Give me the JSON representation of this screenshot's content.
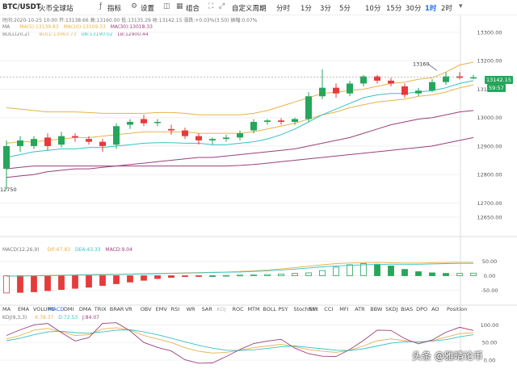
{
  "toolbar": {
    "symbol": "BTC/USDT",
    "exchange": "火币全球站",
    "indicators_label": "指标",
    "settings_label": "设置",
    "layout_label": "组合",
    "periods": [
      "分时",
      "1分",
      "3分",
      "5分",
      "10分",
      "15分",
      "30分",
      "1时",
      "2时"
    ],
    "custom_label": "自定义周期"
  },
  "info": {
    "date": "时间:2020-10-25 10:00",
    "open": "开:13138.66",
    "high": "高:13160.00",
    "low": "低:13135.29",
    "close": "收:13142.15",
    "change": "涨跌:+0.03%(3.50)",
    "amplitude": "振幅:0.07%",
    "ma_label": "MA",
    "ma5": "MA(5):13139.83",
    "ma10": "MA(10):13109.33",
    "ma30": "MA(30):13018.33",
    "boll_label": "BOLL(20,2)",
    "boll_mid": "BOLL:13063.73",
    "boll_ub": "UB:13190.02",
    "boll_lb": "LB:12900.44"
  },
  "macd_info": {
    "label": "MACD(12,26,9)",
    "diff": "DIF:67.83",
    "dea": "DEA:43.33",
    "macd": "MACD:9.04"
  },
  "kdj_info": {
    "label": "KDJ(9,3,3)",
    "k": "K:78.37",
    "d": "D:72.53",
    "j": "J:84.07"
  },
  "chart_data": {
    "type": "candlestick",
    "ylim": [
      12600,
      13300
    ],
    "yticks": [
      "13300.00",
      "13200.00",
      "13100.00",
      "13000.00",
      "12900.00",
      "12800.00",
      "12700.00",
      "12650.00"
    ],
    "current_price": "13142.15",
    "countdown": "59:57",
    "high_label": "13160",
    "low_label": "12750",
    "candles": [
      {
        "o": 12820,
        "c": 12900,
        "h": 12920,
        "l": 12750
      },
      {
        "o": 12900,
        "c": 12920,
        "h": 12935,
        "l": 12880
      },
      {
        "o": 12900,
        "c": 12925,
        "h": 12935,
        "l": 12890
      },
      {
        "o": 12930,
        "c": 12900,
        "h": 12945,
        "l": 12885
      },
      {
        "o": 12905,
        "c": 12935,
        "h": 12950,
        "l": 12895
      },
      {
        "o": 12935,
        "c": 12930,
        "h": 12945,
        "l": 12915
      },
      {
        "o": 12925,
        "c": 12915,
        "h": 12935,
        "l": 12905
      },
      {
        "o": 12915,
        "c": 12900,
        "h": 12925,
        "l": 12880
      },
      {
        "o": 12905,
        "c": 12970,
        "h": 12980,
        "l": 12890
      },
      {
        "o": 12975,
        "c": 12985,
        "h": 12995,
        "l": 12960
      },
      {
        "o": 12995,
        "c": 12980,
        "h": 13010,
        "l": 12970
      },
      {
        "o": 12985,
        "c": 12985,
        "h": 12995,
        "l": 12970
      },
      {
        "o": 12960,
        "c": 12955,
        "h": 12975,
        "l": 12940
      },
      {
        "o": 12955,
        "c": 12935,
        "h": 12965,
        "l": 12925
      },
      {
        "o": 12935,
        "c": 12920,
        "h": 12945,
        "l": 12905
      },
      {
        "o": 12920,
        "c": 12925,
        "h": 12930,
        "l": 12905
      },
      {
        "o": 12925,
        "c": 12930,
        "h": 12940,
        "l": 12915
      },
      {
        "o": 12930,
        "c": 12945,
        "h": 12955,
        "l": 12920
      },
      {
        "o": 12955,
        "c": 12985,
        "h": 12995,
        "l": 12945
      },
      {
        "o": 12985,
        "c": 12990,
        "h": 12995,
        "l": 12975
      },
      {
        "o": 12990,
        "c": 12985,
        "h": 12998,
        "l": 12975
      },
      {
        "o": 12985,
        "c": 12995,
        "h": 13000,
        "l": 12975
      },
      {
        "o": 12995,
        "c": 13075,
        "h": 13090,
        "l": 12985
      },
      {
        "o": 13075,
        "c": 13105,
        "h": 13170,
        "l": 13065
      },
      {
        "o": 13105,
        "c": 13085,
        "h": 13120,
        "l": 13070
      },
      {
        "o": 13085,
        "c": 13120,
        "h": 13130,
        "l": 13075
      },
      {
        "o": 13120,
        "c": 13145,
        "h": 13150,
        "l": 13110
      },
      {
        "o": 13145,
        "c": 13130,
        "h": 13150,
        "l": 13120
      },
      {
        "o": 13130,
        "c": 13120,
        "h": 13140,
        "l": 13110
      },
      {
        "o": 13110,
        "c": 13080,
        "h": 13120,
        "l": 13070
      },
      {
        "o": 13085,
        "c": 13095,
        "h": 13105,
        "l": 13075
      },
      {
        "o": 13095,
        "c": 13125,
        "h": 13135,
        "l": 13090
      },
      {
        "o": 13125,
        "c": 13145,
        "h": 13160,
        "l": 13115
      },
      {
        "o": 13145,
        "c": 13140,
        "h": 13160,
        "l": 13135
      },
      {
        "o": 13140,
        "c": 13142,
        "h": 13150,
        "l": 13135
      }
    ],
    "upper_band": [
      13035,
      13030,
      13025,
      13020,
      13020,
      13020,
      13018,
      13015,
      13015,
      13015,
      13015,
      13018,
      13018,
      13015,
      13010,
      13010,
      13010,
      13010,
      13015,
      13025,
      13040,
      13055,
      13070,
      13085,
      13090,
      13095,
      13100,
      13110,
      13120,
      13125,
      13135,
      13140,
      13160,
      13185,
      13195
    ],
    "mid_band": [
      12910,
      12915,
      12915,
      12920,
      12925,
      12930,
      12930,
      12935,
      12940,
      12945,
      12950,
      12950,
      12950,
      12950,
      12945,
      12945,
      12945,
      12945,
      12950,
      12960,
      12970,
      12980,
      12995,
      13010,
      13020,
      13035,
      13045,
      13055,
      13060,
      13065,
      13075,
      13080,
      13090,
      13105,
      13115
    ],
    "lower_band": [
      12790,
      12795,
      12800,
      12810,
      12815,
      12820,
      12820,
      12825,
      12830,
      12835,
      12840,
      12845,
      12850,
      12855,
      12860,
      12860,
      12865,
      12870,
      12875,
      12880,
      12885,
      12890,
      12900,
      12910,
      12920,
      12930,
      12945,
      12960,
      12975,
      12985,
      12995,
      13000,
      13010,
      13020,
      13025
    ],
    "ma_a": [
      12860,
      12870,
      12880,
      12885,
      12890,
      12890,
      12895,
      12895,
      12900,
      12905,
      12910,
      12912,
      12912,
      12910,
      12910,
      12905,
      12905,
      12910,
      12915,
      12925,
      12940,
      12960,
      12985,
      13010,
      13030,
      13050,
      13070,
      13080,
      13085,
      13085,
      13090,
      13095,
      13105,
      13120,
      13130
    ],
    "ma_b": [
      12820,
      12825,
      12830,
      12830,
      12830,
      12830,
      12830,
      12830,
      12830,
      12830,
      12830,
      12830,
      12830,
      12830,
      12830,
      12830,
      12830,
      12832,
      12835,
      12840,
      12845,
      12850,
      12855,
      12860,
      12865,
      12870,
      12875,
      12880,
      12885,
      12890,
      12895,
      12900,
      12910,
      12920,
      12930
    ],
    "macd": {
      "ylim": [
        -80,
        80
      ],
      "ticks": [
        "50.00",
        "0.00",
        "-50.00"
      ],
      "hist": [
        -60,
        -58,
        -56,
        -52,
        -48,
        -44,
        -40,
        -34,
        -28,
        -22,
        -16,
        -10,
        -6,
        -3,
        -1,
        0,
        1,
        2,
        3,
        4,
        6,
        8,
        10,
        18,
        30,
        38,
        42,
        40,
        34,
        22,
        14,
        10,
        8,
        8,
        9
      ],
      "dif": [
        -2,
        -1,
        0,
        1,
        2,
        3,
        4,
        5,
        5,
        6,
        7,
        8,
        9,
        10,
        11,
        12,
        13,
        15,
        17,
        20,
        24,
        28,
        33,
        38,
        42,
        44,
        45,
        46,
        45,
        44,
        44,
        45,
        46,
        47,
        47
      ],
      "dea": [
        -1,
        -1,
        0,
        0,
        1,
        2,
        3,
        3,
        4,
        5,
        6,
        7,
        8,
        9,
        10,
        11,
        12,
        13,
        15,
        17,
        20,
        23,
        27,
        31,
        34,
        36,
        38,
        39,
        40,
        40,
        40,
        41,
        42,
        43,
        43
      ]
    },
    "kdj": {
      "ylim": [
        0,
        110
      ],
      "ticks": [
        "100.00",
        "50.00",
        "0.00"
      ],
      "k": [
        60,
        70,
        85,
        90,
        80,
        70,
        72,
        88,
        92,
        85,
        70,
        60,
        50,
        35,
        25,
        20,
        22,
        28,
        35,
        40,
        45,
        38,
        30,
        25,
        22,
        28,
        40,
        55,
        60,
        55,
        50,
        55,
        65,
        75,
        78
      ],
      "d": [
        55,
        62,
        72,
        80,
        82,
        78,
        76,
        80,
        85,
        86,
        80,
        72,
        62,
        52,
        42,
        34,
        28,
        27,
        29,
        33,
        38,
        40,
        36,
        32,
        28,
        27,
        32,
        40,
        48,
        52,
        52,
        54,
        58,
        66,
        72
      ],
      "j": [
        70,
        86,
        100,
        104,
        78,
        54,
        64,
        104,
        106,
        83,
        50,
        36,
        26,
        1,
        -9,
        -8,
        10,
        30,
        47,
        54,
        59,
        34,
        18,
        11,
        10,
        30,
        56,
        85,
        84,
        61,
        46,
        57,
        79,
        93,
        84
      ]
    }
  },
  "indicator_tabs": [
    "MA",
    "EMA",
    "VOLUME",
    "MACD",
    "DMI",
    "DMA",
    "TRIX",
    "BRAR",
    "VR",
    "OBV",
    "EMV",
    "RSI",
    "WR",
    "SAR",
    "KDJ",
    "ROC",
    "MTM",
    "BOLL",
    "PSY",
    "StochRSI",
    "SMI",
    "CCI",
    "MFI",
    "ATR",
    "BBW",
    "SKDJ",
    "BIAS",
    "DPO",
    "AO",
    "Position"
  ],
  "watermark": "头条 @雅晴论币",
  "colors": {
    "up": "#e63b3b",
    "down": "#26a65b",
    "ma_orange": "#e7b24a",
    "ma_cyan": "#34c1c8",
    "ma_purple": "#9a3f7a"
  }
}
